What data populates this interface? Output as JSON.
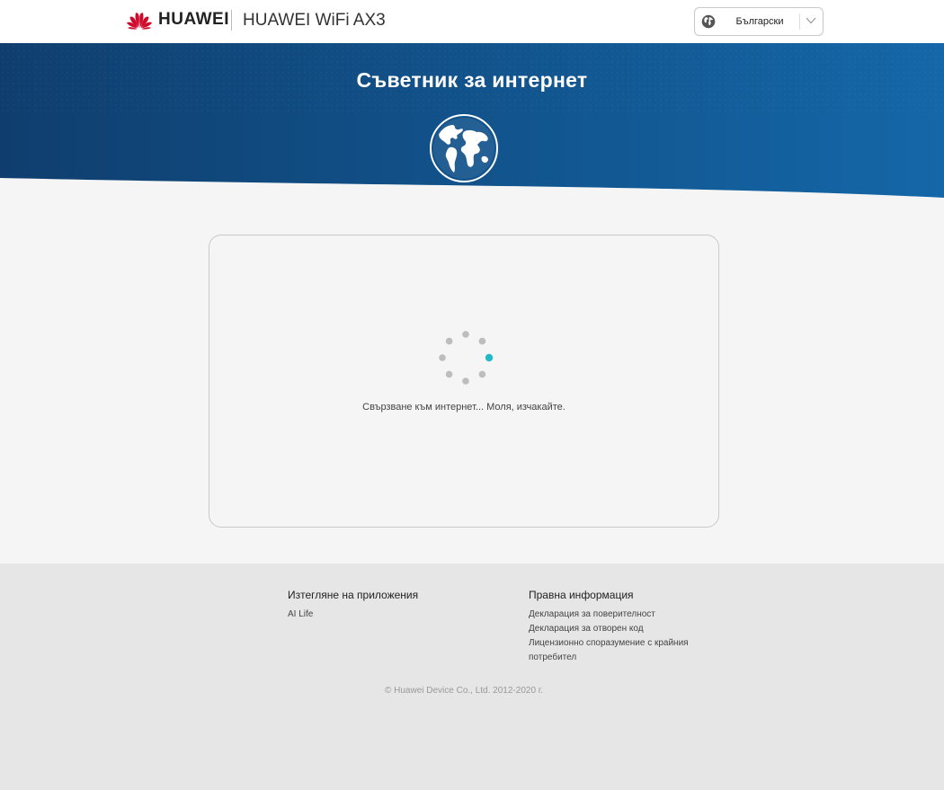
{
  "header": {
    "brand": "HUAWEI",
    "product": "HUAWEI WiFi AX3",
    "language": "Български",
    "brand_color": "#cf0a2c"
  },
  "banner": {
    "title": "Съветник за интернет",
    "colors": {
      "dark": "#0f3e6e",
      "light": "#1467a8"
    }
  },
  "status": {
    "message": "Свързване към интернет... Моля, изчакайте.",
    "spinner_active_color": "#26b8c6",
    "spinner_color": "#bdbdbd"
  },
  "footer": {
    "apps_heading": "Изтегляне на приложения",
    "apps_links": [
      "AI Life"
    ],
    "legal_heading": "Правна информация",
    "legal_links": [
      "Декларация за поверителност",
      "Декларация за отворен код",
      "Лицензионно споразумение с крайния потребител"
    ],
    "copyright": "© Huawei Device Co., Ltd. 2012-2020 г."
  }
}
